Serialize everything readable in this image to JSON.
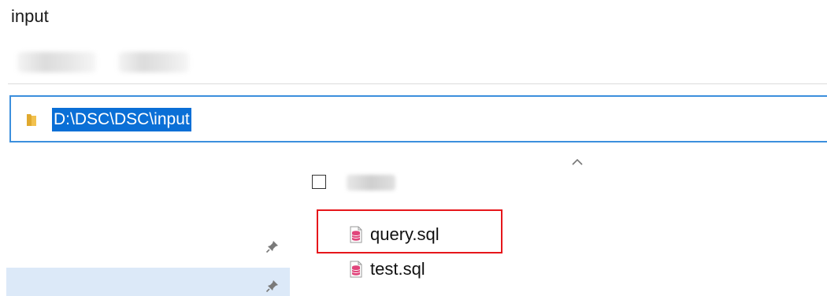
{
  "window": {
    "title": "input"
  },
  "address_bar": {
    "path": "D:\\DSC\\DSC\\input",
    "icon": "folder-icon"
  },
  "navigation": {
    "icons": [
      "pin-icon",
      "pin-icon"
    ]
  },
  "file_list": {
    "sort_icon": "chevron-up-icon",
    "files": [
      {
        "name": "query.sql",
        "icon": "sql-file-icon",
        "highlighted": true
      },
      {
        "name": "test.sql",
        "icon": "sql-file-icon",
        "highlighted": false
      }
    ]
  },
  "colors": {
    "selection_blue": "#0a6fd6",
    "address_border": "#3c8fdd",
    "highlight_red": "#e6161b",
    "nav_selected_bg": "#dce9f8",
    "folder_yellow": "#f2c14e",
    "sql_icon_pink": "#e0457b"
  }
}
